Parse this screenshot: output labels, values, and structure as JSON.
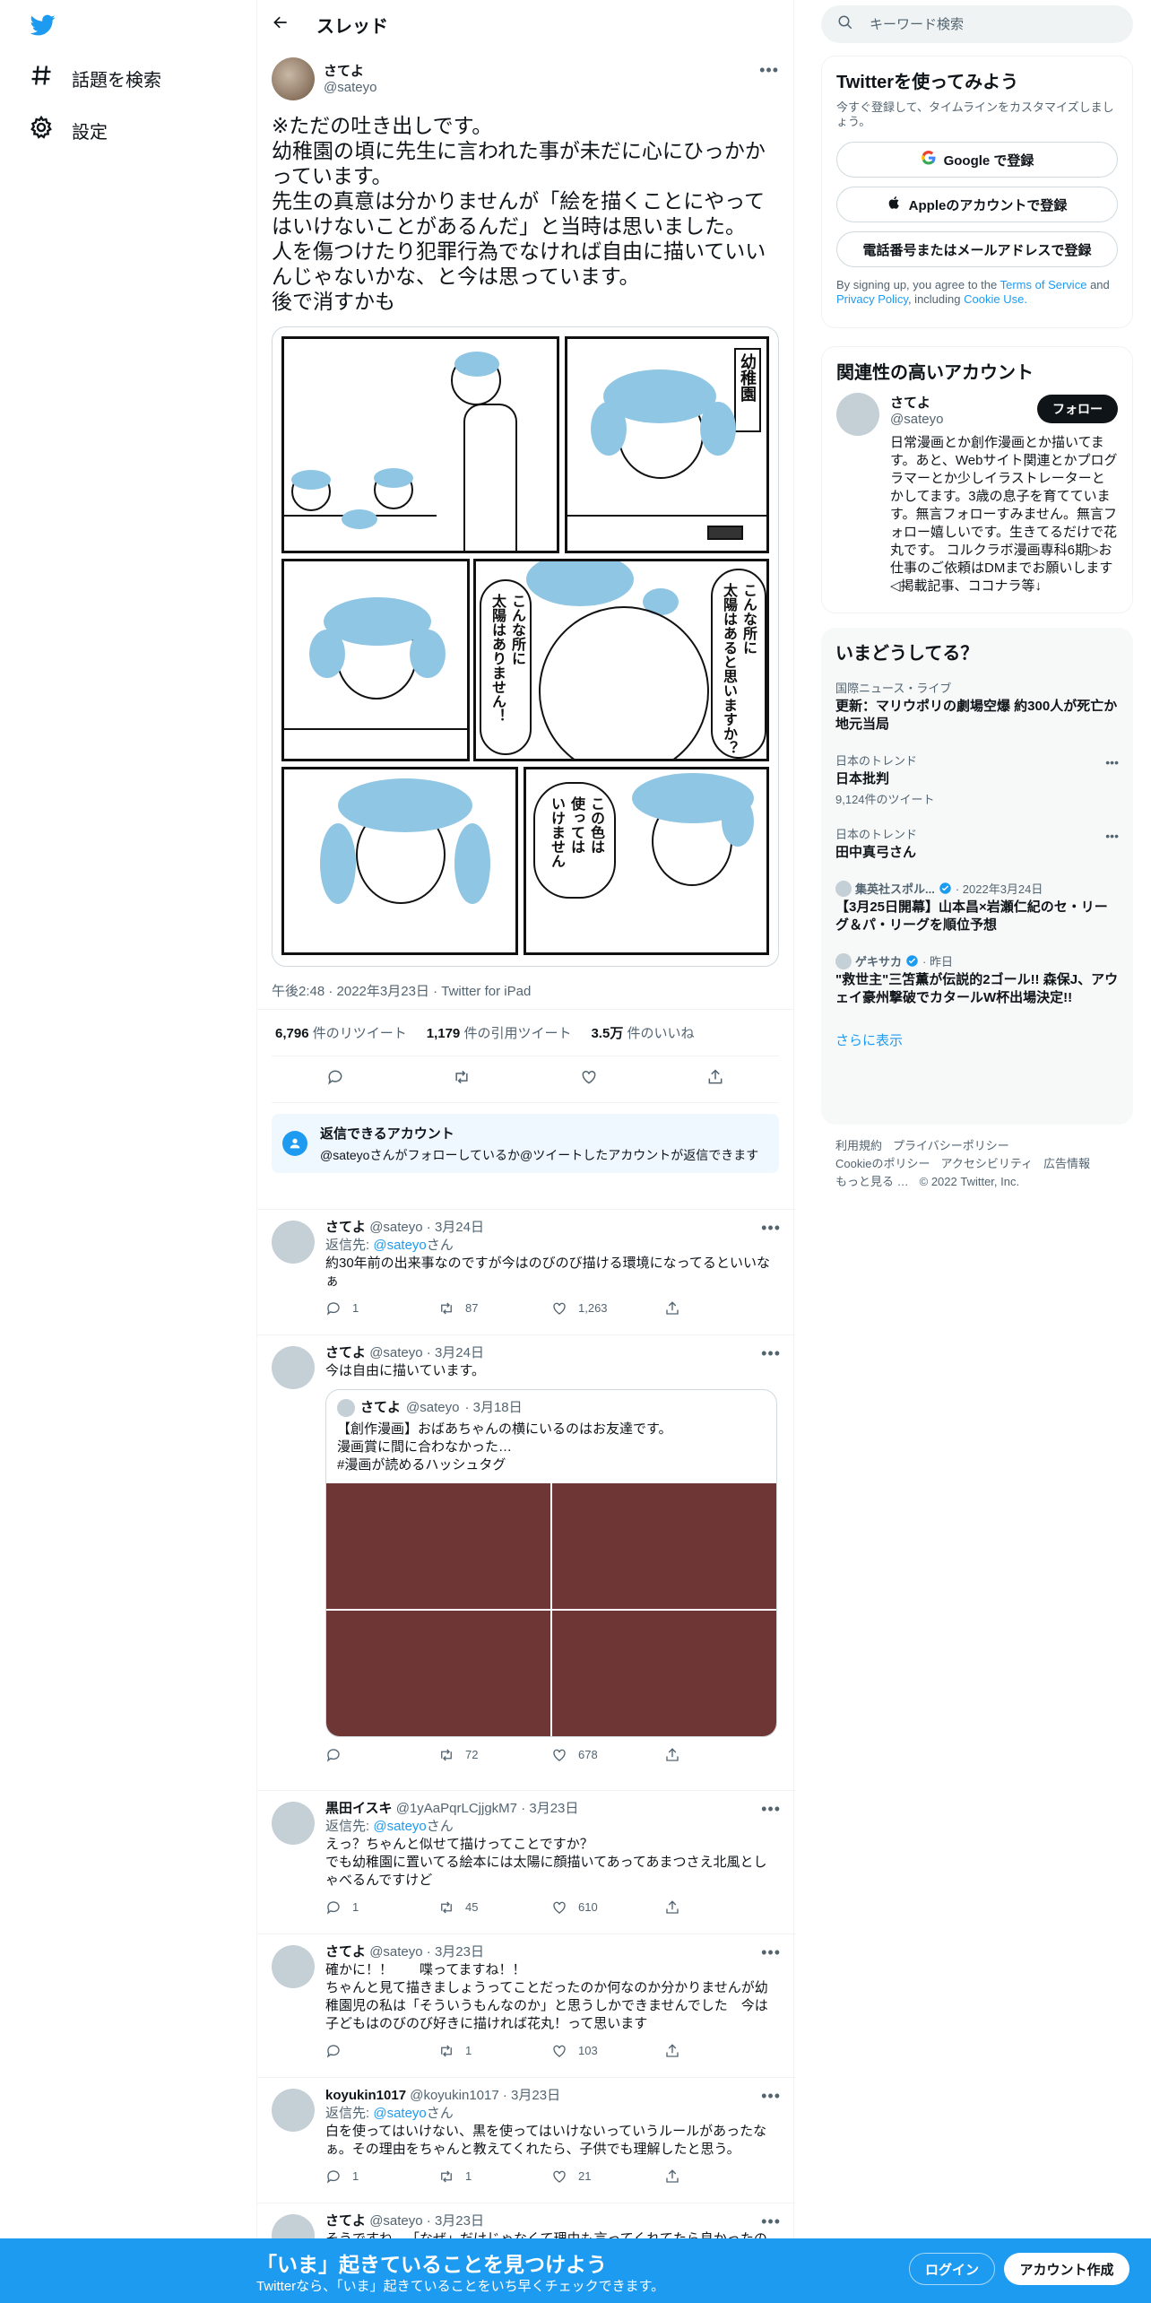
{
  "nav": {
    "explore_label": "話題を検索",
    "settings_label": "設定"
  },
  "header": {
    "title": "スレッド"
  },
  "tweet": {
    "name": "さてよ",
    "handle": "@sateyo",
    "text": "※ただの吐き出しです。\n幼稚園の頃に先生に言われた事が未だに心にひっかかっています。\n先生の真意は分かりませんが「絵を描くことにやってはいけないことがあるんだ」と当時は思いました。\n人を傷つけたり犯罪行為でなければ自由に描いていいんじゃないかな、と今は思っています。\n後で消すかも",
    "comic_text": {
      "sign": "幼稚園",
      "bubble1": "こんな所に\n太陽はあると思いますか？",
      "bubble2": "こんな所に\n太陽はありません！",
      "bubble3": "この色は\n使っては\nいけません"
    },
    "meta": "午後2:48 · 2022年3月23日 · Twitter for iPad",
    "retweets_num": "6,796",
    "retweets_label": "件のリツイート",
    "quotes_num": "1,179",
    "quotes_label": "件の引用ツイート",
    "likes_num": "3.5万",
    "likes_label": "件のいいね"
  },
  "reply_notice": {
    "title": "返信できるアカウント",
    "sub": "@sateyoさんがフォローしているか@ツイートしたアカウントが返信できます"
  },
  "replies": [
    {
      "name": "さてよ",
      "handle": "@sateyo",
      "date": "· 3月24日",
      "reply_to_prefix": "返信先:",
      "reply_to_handle": "@sateyo",
      "reply_to_suffix": "さん",
      "text": "約30年前の出来事なのですが今はのびのび描ける環境になってるといいなぁ",
      "replies": "1",
      "retweets": "87",
      "likes": "1,263"
    },
    {
      "name": "さてよ",
      "handle": "@sateyo",
      "date": "· 3月24日",
      "text": "今は自由に描いています。",
      "quote": {
        "name": "さてよ",
        "handle": "@sateyo",
        "date": "· 3月18日",
        "text": "【創作漫画】おばあちゃんの横にいるのはお友達です。\n漫画賞に間に合わなかった…\n#漫画が読めるハッシュタグ"
      },
      "replies": "",
      "retweets": "72",
      "likes": "678"
    },
    {
      "name": "黒田イスキ",
      "handle": "@1yAaPqrLCjjgkM7",
      "date": "· 3月23日",
      "reply_to_prefix": "返信先:",
      "reply_to_handle": "@sateyo",
      "reply_to_suffix": "さん",
      "text": "えっ？ちゃんと似せて描けってことですか？\nでも幼稚園に置いてる絵本には太陽に顔描いてあってあまつさえ北風としゃべるんですけど",
      "replies": "1",
      "retweets": "45",
      "likes": "610"
    },
    {
      "name": "さてよ",
      "handle": "@sateyo",
      "date": "· 3月23日",
      "text": "確かに！！　　喋ってますね！！\nちゃんと見て描きましょうってことだったのか何なのか分かりませんが幼稚園児の私は「そういうもんなのか」と思うしかできませんでした　今は子どもはのびのび好きに描ければ花丸！って思います",
      "replies": "",
      "retweets": "1",
      "likes": "103"
    },
    {
      "name": "koyukin1017",
      "handle": "@koyukin1017",
      "date": "· 3月23日",
      "reply_to_prefix": "返信先:",
      "reply_to_handle": "@sateyo",
      "reply_to_suffix": "さん",
      "text": "白を使ってはいけない、黒を使ってはいけないっていうルールがあったなぁ。その理由をちゃんと教えてくれたら、子供でも理解したと思う。",
      "replies": "1",
      "retweets": "1",
      "likes": "21"
    },
    {
      "name": "さてよ",
      "handle": "@sateyo",
      "date": "· 3月23日",
      "text": "そうですね…「なぜ」だけじゃなくて理由も言ってくれてたら良かったの"
    }
  ],
  "right": {
    "search_placeholder": "キーワード検索",
    "signup": {
      "title": "Twitterを使ってみよう",
      "sub": "今すぐ登録して、タイムラインをカスタマイズしましょう。",
      "google": "Google で登録",
      "apple": "Appleのアカウントで登録",
      "phone": "電話番号またはメールアドレスで登録",
      "terms_prefix": "By signing up, you agree to the",
      "terms_link": "Terms of Service",
      "terms_and": "and",
      "privacy_link": "Privacy Policy",
      "terms_including": ", including",
      "cookie_link": "Cookie Use."
    },
    "related": {
      "title": "関連性の高いアカウント",
      "name": "さてよ",
      "handle": "@sateyo",
      "follow": "フォロー",
      "bio": "日常漫画とか創作漫画とか描いてます。あと、Webサイト関連とかプログラマーとか少しイラストレーターとかしてます。3歳の息子を育てています。無言フォローすみません。無言フォロー嬉しいです。生きてるだけで花丸です。 コルクラボ漫画専科6期▷お仕事のご依頼はDMまでお願いします◁掲載記事、ココナラ等↓"
    },
    "trends": {
      "title": "いまどうしてる？",
      "items": [
        {
          "ctx": "国際ニュース・ライブ",
          "title": "更新：マリウポリの劇場空爆 約300人が死亡か 地元当局"
        },
        {
          "ctx": "日本のトレンド",
          "title": "日本批判",
          "count": "9,124件のツイート"
        },
        {
          "ctx": "日本のトレンド",
          "title": "田中真弓さん"
        },
        {
          "ctx": "集英社スポル...",
          "ctx_date": "· 2022年3月24日",
          "title": "【3月25日開幕】山本昌×岩瀬仁紀のセ・リーグ＆パ・リーグを順位予想"
        },
        {
          "ctx": "ゲキサカ",
          "ctx_date": "· 昨日",
          "title": "\"救世主\"三笘薫が伝説的2ゴール!! 森保J、アウェイ豪州撃破でカタールW杯出場決定!!"
        }
      ],
      "show_more": "さらに表示"
    },
    "footer": {
      "l1a": "利用規約",
      "l1b": "プライバシーポリシー",
      "l2a": "Cookieのポリシー",
      "l2b": "アクセシビリティ",
      "l2c": "広告情報",
      "l3a": "もっと見る …",
      "l3b": "© 2022 Twitter, Inc."
    }
  },
  "bottom": {
    "title": "「いま」起きていることを見つけよう",
    "sub": "Twitterなら、「いま」起きていることをいち早くチェックできます。",
    "login": "ログイン",
    "signup": "アカウント作成"
  },
  "colors": {
    "accent": "#1d9bf0",
    "comic_blue": "#8fc6e4",
    "thumb": "#6f3636"
  }
}
